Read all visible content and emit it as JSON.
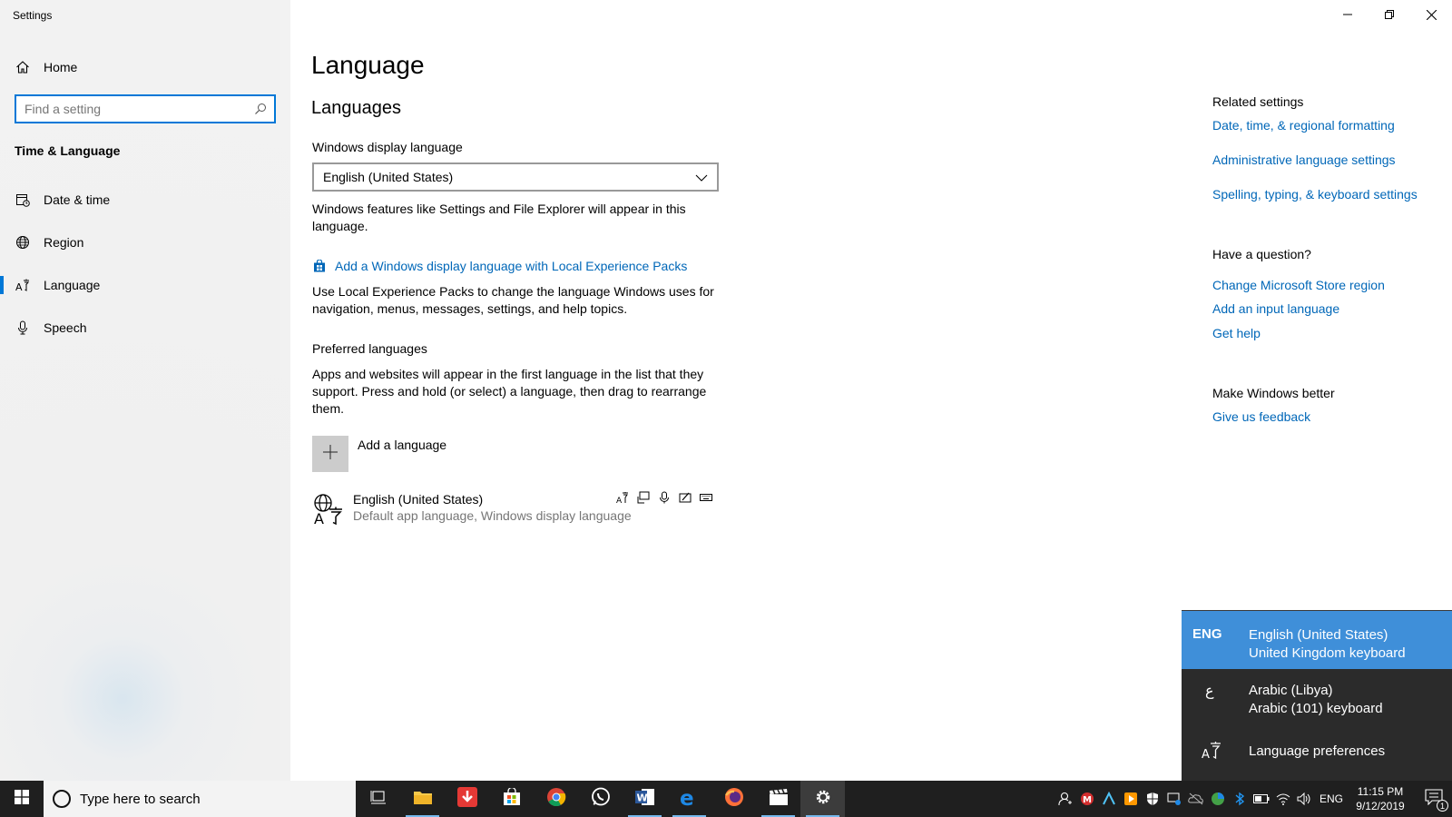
{
  "window": {
    "title": "Settings"
  },
  "sidebar": {
    "home_label": "Home",
    "search_placeholder": "Find a setting",
    "section_title": "Time & Language",
    "items": [
      {
        "label": "Date & time",
        "icon": "calendar-icon"
      },
      {
        "label": "Region",
        "icon": "globe-icon"
      },
      {
        "label": "Language",
        "icon": "language-icon",
        "active": true
      },
      {
        "label": "Speech",
        "icon": "microphone-icon"
      }
    ]
  },
  "main": {
    "title": "Language",
    "languages_heading": "Languages",
    "display_language_label": "Windows display language",
    "display_language_value": "English (United States)",
    "display_language_desc": "Windows features like Settings and File Explorer will appear in this language.",
    "lxp_link": "Add a Windows display language with Local Experience Packs",
    "lxp_desc": "Use Local Experience Packs to change the language Windows uses for navigation, menus, messages, settings, and help topics.",
    "preferred_label": "Preferred languages",
    "preferred_desc": "Apps and websites will appear in the first language in the list that they support. Press and hold (or select) a language, then drag to rearrange them.",
    "add_language_label": "Add a language",
    "language_entry": {
      "name": "English (United States)",
      "sub": "Default app language, Windows display language"
    }
  },
  "related": {
    "heading": "Related settings",
    "links": [
      "Date, time, & regional formatting",
      "Administrative language settings",
      "Spelling, typing, & keyboard settings"
    ],
    "question_heading": "Have a question?",
    "question_links": [
      "Change Microsoft Store region",
      "Add an input language",
      "Get help"
    ],
    "better_heading": "Make Windows better",
    "feedback_link": "Give us feedback"
  },
  "flyout": {
    "items": [
      {
        "abbr": "ENG",
        "line1": "English (United States)",
        "line2": "United Kingdom keyboard",
        "selected": true
      },
      {
        "abbr": "ع",
        "line1": "Arabic (Libya)",
        "line2": "Arabic (101) keyboard",
        "selected": false
      }
    ],
    "preferences_label": "Language preferences"
  },
  "taskbar": {
    "search_placeholder": "Type here to search",
    "tray_lang": "ENG",
    "time": "11:15 PM",
    "date": "9/12/2019",
    "notification_count": "1"
  },
  "colors": {
    "accent": "#0078d7",
    "link": "#0067b8",
    "flyout_bg": "#2b2b2b",
    "flyout_selected": "#3f8fd9",
    "taskbar_bg": "#1f1f1f"
  }
}
